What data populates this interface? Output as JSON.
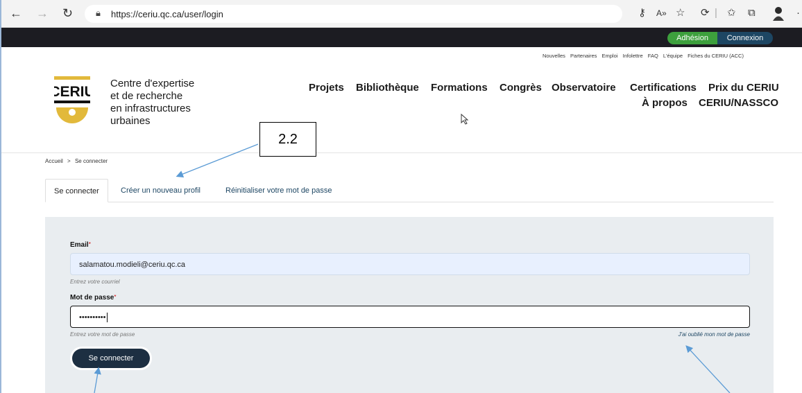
{
  "browser": {
    "url": "https://ceriu.qc.ca/user/login",
    "icons": [
      "back-icon",
      "forward-icon",
      "reload-icon",
      "lock-icon",
      "key-icon",
      "read-aloud-icon",
      "favorite-icon",
      "extensions-icon",
      "favorites-icon",
      "collections-icon",
      "profile-icon"
    ]
  },
  "topbar": {
    "adhesion_label": "Adhésion",
    "connexion_label": "Connexion",
    "colors": {
      "adhesion": "#3da03d",
      "connexion": "#1d4663",
      "bar": "#1c1c22"
    }
  },
  "util_nav": [
    "Nouvelles",
    "Partenaires",
    "Emploi",
    "Infolettre",
    "FAQ",
    "L'équipe",
    "Fiches du CERIU (ACC)"
  ],
  "logo": {
    "text": "CERIU",
    "accent": "#e2b93b"
  },
  "org_name": [
    "Centre d'expertise",
    "et de recherche",
    "en infrastructures",
    "urbaines"
  ],
  "main_nav": {
    "row1": [
      "Projets",
      "Bibliothèque",
      "Formations",
      "Congrès",
      "Observatoire",
      "Certifications",
      "Prix du CERIU"
    ],
    "row2": [
      "À propos",
      "CERIU/NASSCO"
    ]
  },
  "annotation": {
    "label": "2.2"
  },
  "breadcrumb": {
    "home": "Accueil",
    "sep": ">",
    "current": "Se connecter"
  },
  "tabs": [
    "Se connecter",
    "Créer un nouveau profil",
    "Réinitialiser votre mot de passe"
  ],
  "form": {
    "email_label": "Email",
    "email_value": "salamatou.modieli@ceriu.qc.ca",
    "email_hint": "Entrez votre courriel",
    "password_label": "Mot de passe",
    "password_value": "••••••••••",
    "password_hint": "Entrez votre mot de passe",
    "forgot_link": "J'ai oublié mon mot de passe",
    "submit_label": "Se connecter",
    "required_mark": "*"
  }
}
